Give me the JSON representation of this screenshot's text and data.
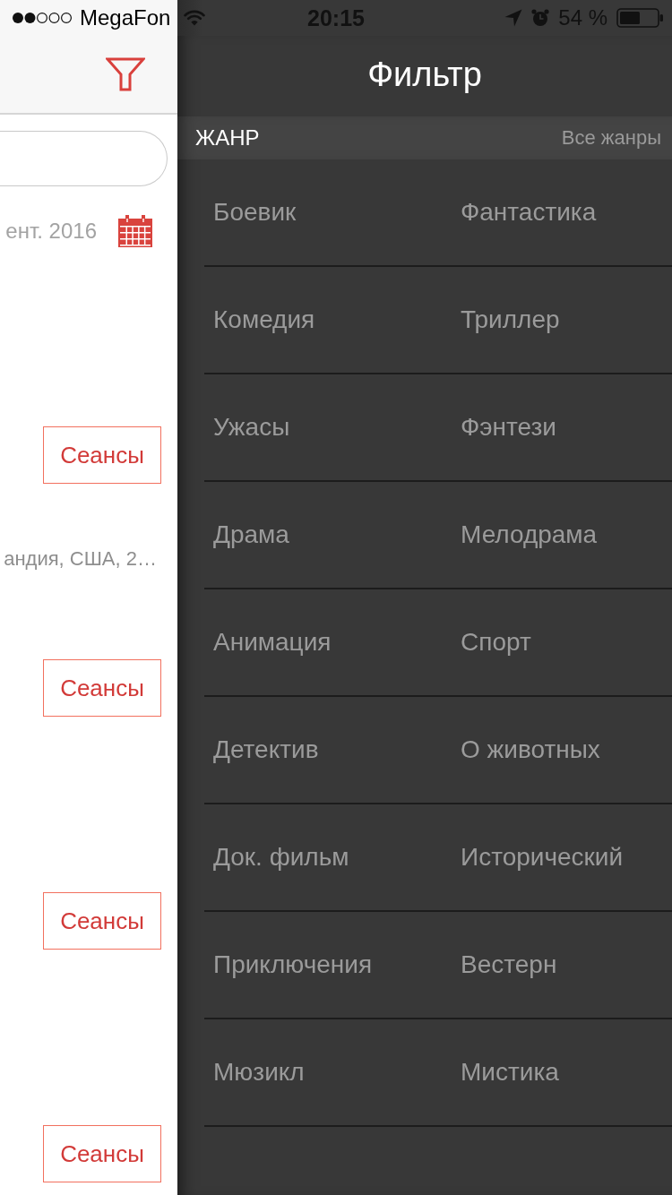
{
  "status_bar": {
    "carrier": "MegaFon",
    "time": "20:15",
    "battery": "54 %"
  },
  "main": {
    "date": "ент. 2016",
    "movies": [
      {
        "button": "Сеансы"
      },
      {
        "info": "андия, США, 2…",
        "button": "Сеансы"
      },
      {
        "button": "Сеансы"
      },
      {
        "button": "Сеансы"
      }
    ]
  },
  "filter": {
    "title": "Фильтр",
    "section": {
      "title": "ЖАНР",
      "action": "Все жанры"
    },
    "genres": [
      {
        "label": "Боевик",
        "selected": false
      },
      {
        "label": "Фантастика",
        "selected": false
      },
      {
        "label": "Комедия",
        "selected": false
      },
      {
        "label": "Триллер",
        "selected": false
      },
      {
        "label": "Ужасы",
        "selected": false
      },
      {
        "label": "Фэнтези",
        "selected": false
      },
      {
        "label": "Драма",
        "selected": false
      },
      {
        "label": "Мелодрама",
        "selected": false
      },
      {
        "label": "Анимация",
        "selected": false
      },
      {
        "label": "Спорт",
        "selected": false
      },
      {
        "label": "Детектив",
        "selected": false
      },
      {
        "label": "О животных",
        "selected": false
      },
      {
        "label": "Док. фильм",
        "selected": false
      },
      {
        "label": "Исторический",
        "selected": false
      },
      {
        "label": "Приключения",
        "selected": false
      },
      {
        "label": "Вестерн",
        "selected": false
      },
      {
        "label": "Мюзикл",
        "selected": false
      },
      {
        "label": "Мистика",
        "selected": false
      }
    ]
  }
}
